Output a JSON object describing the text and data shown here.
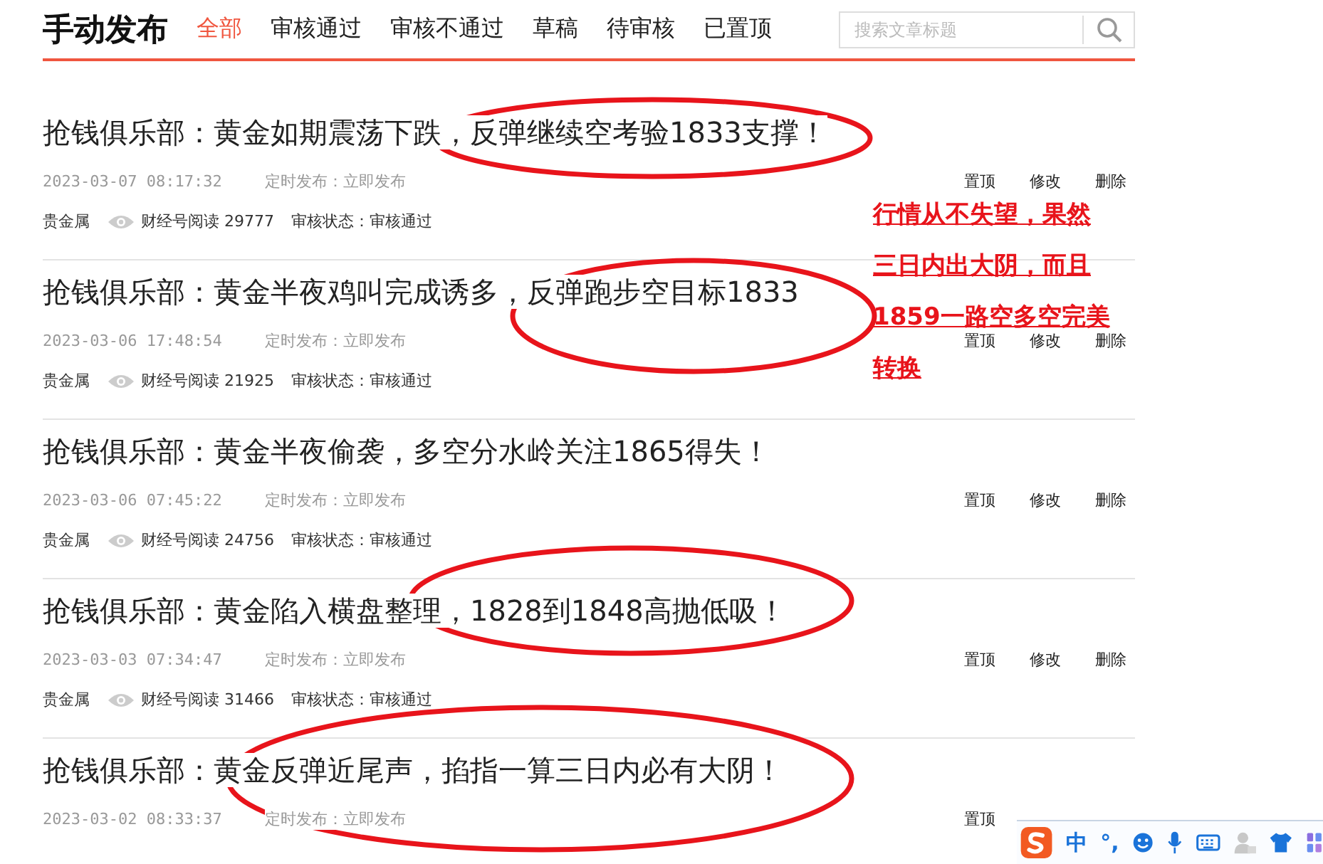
{
  "header": {
    "title": "手动发布",
    "tabs": [
      {
        "label": "全部",
        "selected": true
      },
      {
        "label": "审核通过",
        "selected": false
      },
      {
        "label": "审核不通过",
        "selected": false
      },
      {
        "label": "草稿",
        "selected": false
      },
      {
        "label": "待审核",
        "selected": false
      },
      {
        "label": "已置顶",
        "selected": false
      }
    ],
    "search": {
      "placeholder": "搜索文章标题"
    }
  },
  "articles": [
    {
      "title": "抢钱俱乐部：黄金如期震荡下跌，反弹继续空考验1833支撑！",
      "date": "2023-03-07 08:17:32",
      "schedule": "定时发布：立即发布",
      "actions": [
        "置顶",
        "修改",
        "删除"
      ],
      "category": "贵金属",
      "reads": "财经号阅读 29777",
      "review": "审核状态：审核通过",
      "circled": true
    },
    {
      "title": "抢钱俱乐部：黄金半夜鸡叫完成诱多，反弹跑步空目标1833",
      "date": "2023-03-06 17:48:54",
      "schedule": "定时发布：立即发布",
      "actions": [
        "置顶",
        "修改",
        "删除"
      ],
      "category": "贵金属",
      "reads": "财经号阅读 21925",
      "review": "审核状态：审核通过",
      "circled": true
    },
    {
      "title": "抢钱俱乐部：黄金半夜偷袭，多空分水岭关注1865得失！",
      "date": "2023-03-06 07:45:22",
      "schedule": "定时发布：立即发布",
      "actions": [
        "置顶",
        "修改",
        "删除"
      ],
      "category": "贵金属",
      "reads": "财经号阅读 24756",
      "review": "审核状态：审核通过",
      "circled": false
    },
    {
      "title": "抢钱俱乐部：黄金陷入横盘整理，1828到1848高抛低吸！",
      "date": "2023-03-03 07:34:47",
      "schedule": "定时发布：立即发布",
      "actions": [
        "置顶",
        "修改",
        "删除"
      ],
      "category": "贵金属",
      "reads": "财经号阅读 31466",
      "review": "审核状态：审核通过",
      "circled": true
    },
    {
      "title": "抢钱俱乐部：黄金反弹近尾声，掐指一算三日内必有大阴！",
      "date": "2023-03-02 08:33:37",
      "schedule": "定时发布：立即发布",
      "actions": [
        "置顶"
      ],
      "circled": true
    }
  ],
  "annotation": {
    "lines": [
      "行情从不失望，果然",
      "三日内出大阴，而且",
      "1859一路空多空完美",
      "转换"
    ]
  },
  "ime_toolbar": {
    "mode": "中",
    "punctuation": "°,"
  }
}
